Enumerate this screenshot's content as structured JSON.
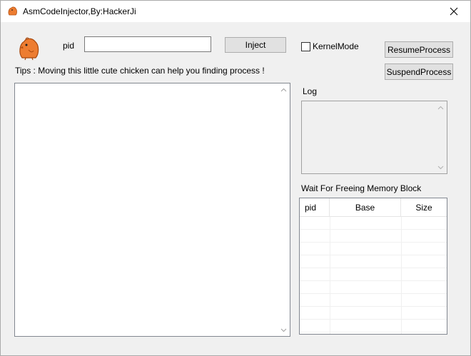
{
  "window": {
    "title": "AsmCodeInjector,By:HackerJi",
    "close_icon": "close-icon"
  },
  "toolbar": {
    "pid_label": "pid",
    "pid_value": "",
    "inject_label": "Inject",
    "kernel_mode_label": "KernelMode",
    "kernel_mode_checked": false,
    "resume_label": "ResumeProcess",
    "suspend_label": "SuspendProcess"
  },
  "tips": "Tips : Moving this little cute chicken can help you finding process !",
  "log": {
    "label": "Log",
    "content": ""
  },
  "memory_blocks": {
    "label": "Wait For Freeing Memory Block",
    "columns": [
      "pid",
      "Base",
      "Size"
    ],
    "rows": []
  },
  "colors": {
    "chicken": "#ed7d31",
    "window_bg": "#f0f0f0",
    "button_bg": "#e1e1e1"
  }
}
